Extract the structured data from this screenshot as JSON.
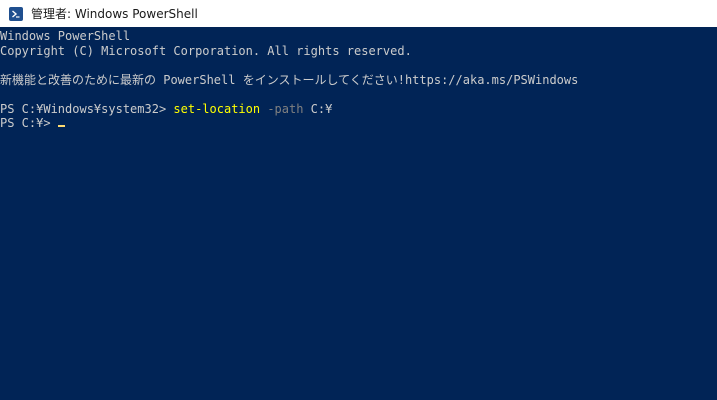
{
  "window": {
    "title": "管理者: Windows PowerShell",
    "icon": "powershell-icon"
  },
  "console": {
    "banner_line1": "Windows PowerShell",
    "banner_line2": "Copyright (C) Microsoft Corporation. All rights reserved.",
    "update_notice": "新機能と改善のために最新の PowerShell をインストールしてください!https://aka.ms/PSWindows",
    "prompt1": "PS C:¥Windows¥system32> ",
    "command": "set-location",
    "param_name": " -path",
    "param_value": " C:¥",
    "prompt2": "PS C:¥> "
  },
  "colors": {
    "background": "#012456",
    "text": "#cccccc",
    "command": "#ffff00",
    "parameter": "#808080",
    "cursor": "#fedb72"
  }
}
